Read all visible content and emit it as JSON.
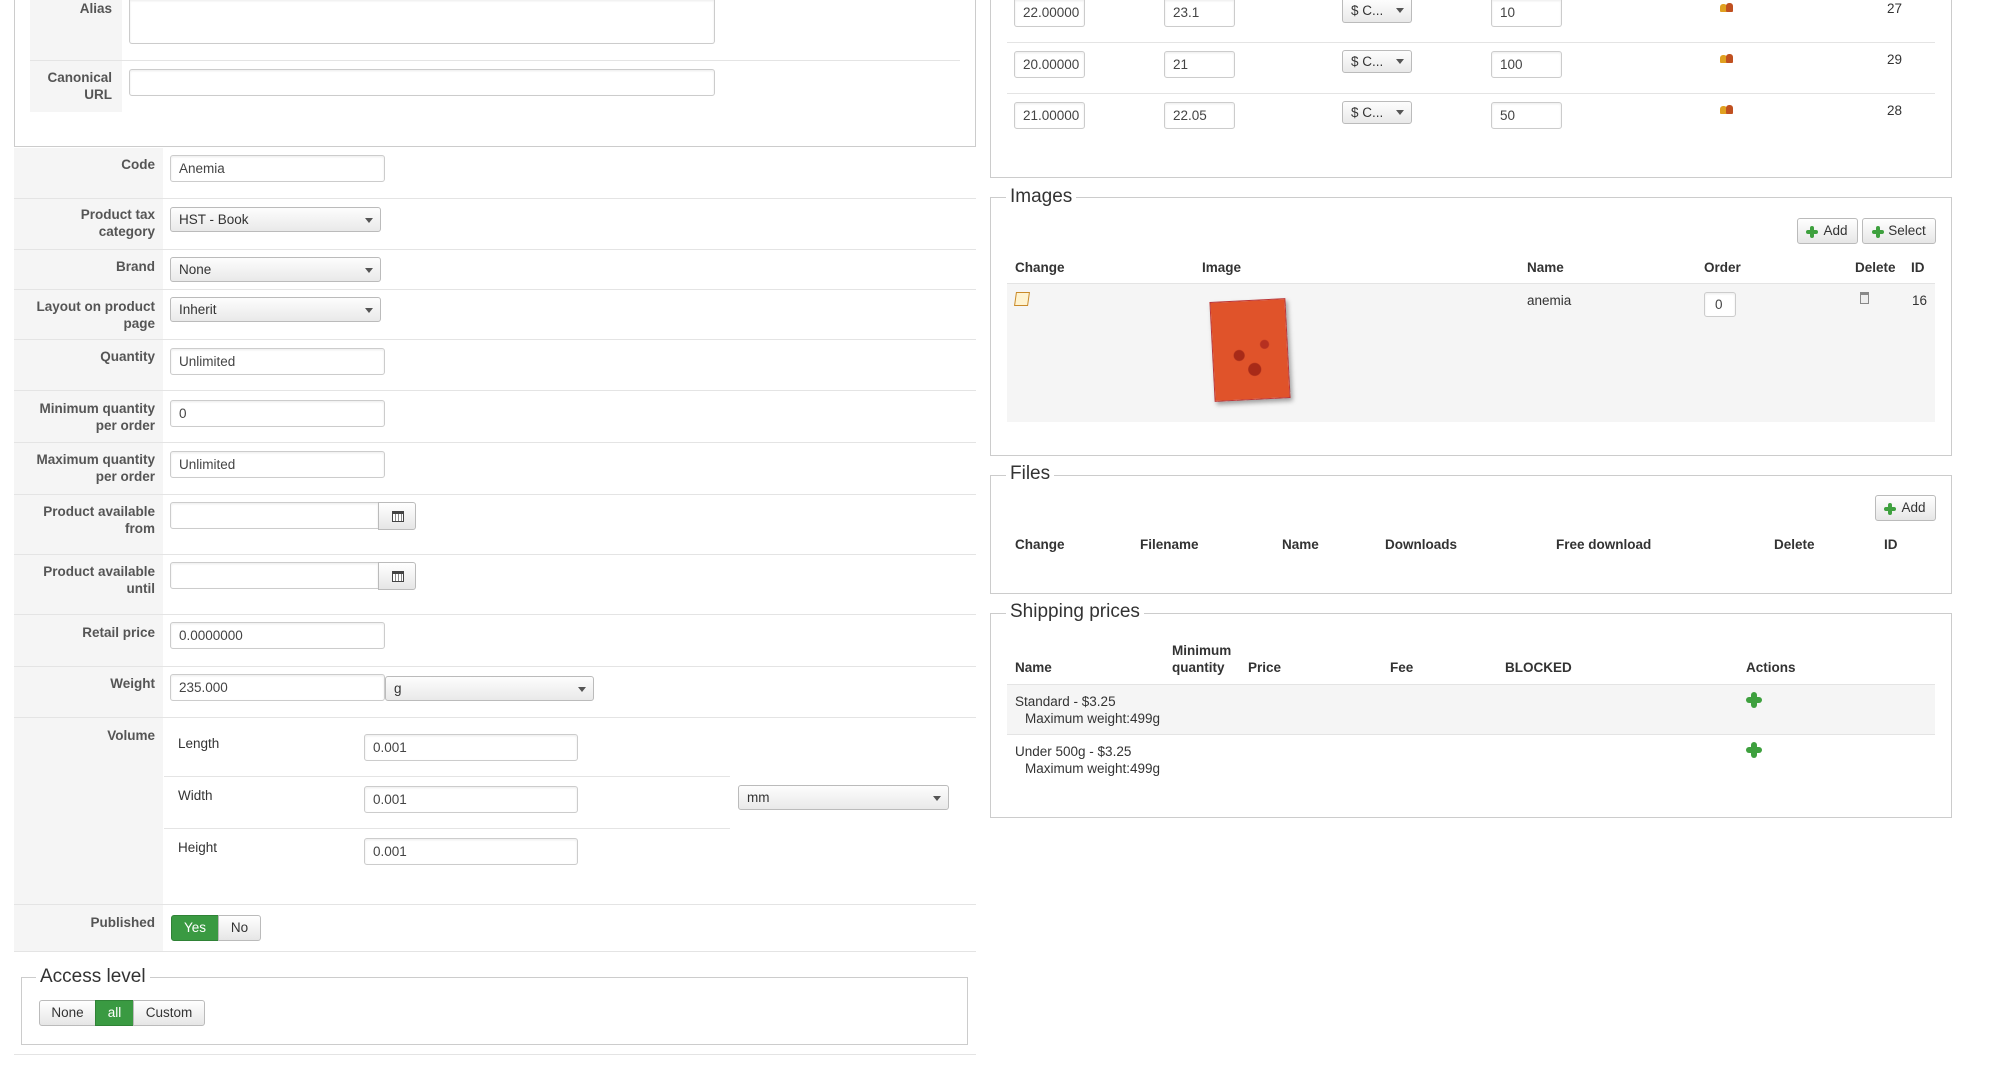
{
  "form": {
    "alias_label": "Alias",
    "alias_value": "",
    "canonical_label": "Canonical URL",
    "canonical_value": "",
    "code_label": "Code",
    "code_value": "Anemia",
    "tax_label": "Product tax category",
    "tax_value": "HST - Book",
    "brand_label": "Brand",
    "brand_value": "None",
    "layout_label": "Layout on product page",
    "layout_value": "Inherit",
    "quantity_label": "Quantity",
    "quantity_value": "Unlimited",
    "min_qty_label": "Minimum quantity per order",
    "min_qty_value": "0",
    "max_qty_label": "Maximum quantity per order",
    "max_qty_value": "Unlimited",
    "avail_from_label": "Product available from",
    "avail_from_value": "",
    "avail_until_label": "Product available until",
    "avail_until_value": "",
    "retail_label": "Retail price",
    "retail_value": "0.0000000",
    "weight_label": "Weight",
    "weight_value": "235.000",
    "weight_unit": "g",
    "volume_label": "Volume",
    "length_label": "Length",
    "length_value": "0.001",
    "width_label": "Width",
    "width_value": "0.001",
    "height_label": "Height",
    "height_value": "0.001",
    "volume_unit": "mm",
    "published_label": "Published",
    "published_yes": "Yes",
    "published_no": "No",
    "published_selected": "Yes"
  },
  "access": {
    "title": "Access level",
    "options": [
      "None",
      "all",
      "Custom"
    ],
    "selected": "all"
  },
  "prices": {
    "rows": [
      {
        "price": "22.00000",
        "price_tax": "23.1",
        "currency": "$ C...",
        "min_qty": "10",
        "id": "27"
      },
      {
        "price": "20.00000",
        "price_tax": "21",
        "currency": "$ C...",
        "min_qty": "100",
        "id": "29"
      },
      {
        "price": "21.00000",
        "price_tax": "22.05",
        "currency": "$ C...",
        "min_qty": "50",
        "id": "28"
      }
    ]
  },
  "images": {
    "title": "Images",
    "add_label": "Add",
    "select_label": "Select",
    "headers": {
      "change": "Change",
      "image": "Image",
      "name": "Name",
      "order": "Order",
      "delete": "Delete",
      "id": "ID"
    },
    "row": {
      "name": "anemia",
      "order": "0",
      "id": "16",
      "cover_color": "#e0532a"
    }
  },
  "files": {
    "title": "Files",
    "add_label": "Add",
    "headers": {
      "change": "Change",
      "filename": "Filename",
      "name": "Name",
      "downloads": "Downloads",
      "free": "Free download",
      "delete": "Delete",
      "id": "ID"
    }
  },
  "shipping": {
    "title": "Shipping prices",
    "headers": {
      "name": "Name",
      "min_qty": "Minimum quantity",
      "price": "Price",
      "fee": "Fee",
      "blocked": "BLOCKED",
      "actions": "Actions"
    },
    "rows": [
      {
        "name": "Standard - $3.25",
        "detail": "Maximum weight:499g"
      },
      {
        "name": "Under 500g - $3.25",
        "detail": "Maximum weight:499g"
      }
    ]
  },
  "colors": {
    "accent_green": "#3a9a42",
    "border": "#cccccc"
  }
}
